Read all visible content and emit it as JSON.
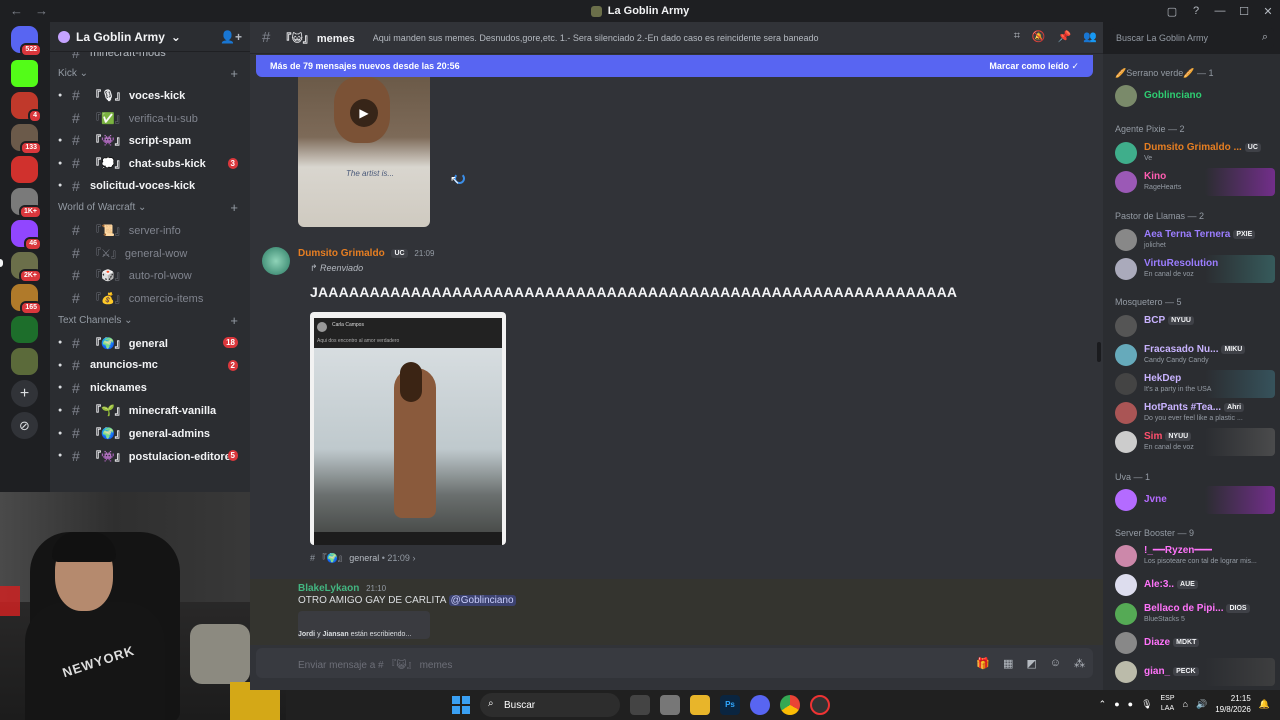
{
  "window": {
    "title": "La Goblin Army",
    "controls": [
      "▢",
      "?",
      "—",
      "☐",
      "✕"
    ]
  },
  "server_rail": {
    "badges": [
      "522",
      "4",
      "133",
      "1K+",
      "46",
      "2K+",
      "165"
    ]
  },
  "sidebar": {
    "server_name": "La Goblin Army",
    "top_cut_channel": "minecraft-mods",
    "categories": [
      {
        "name": "Kick",
        "channels": [
          {
            "label": "『🎙』 voces-kick",
            "unread": true,
            "mention": ""
          },
          {
            "label": "『✅』 verifica-tu-sub",
            "unread": false,
            "mention": ""
          },
          {
            "label": "『👾』 script-spam",
            "unread": true,
            "mention": ""
          },
          {
            "label": "『💭』 chat-subs-kick",
            "unread": true,
            "mention": "3"
          },
          {
            "label": "solicitud-voces-kick",
            "unread": true,
            "mention": ""
          }
        ]
      },
      {
        "name": "World of Warcraft",
        "channels": [
          {
            "label": "『📜』 server-info",
            "unread": false,
            "mention": ""
          },
          {
            "label": "『⚔』 general-wow",
            "unread": false,
            "mention": ""
          },
          {
            "label": "『🎲』 auto-rol-wow",
            "unread": false,
            "mention": ""
          },
          {
            "label": "『💰』 comercio-items",
            "unread": false,
            "mention": ""
          }
        ]
      },
      {
        "name": "Text Channels",
        "channels": [
          {
            "label": "『🌍』 general",
            "unread": true,
            "mention": "18"
          },
          {
            "label": "anuncios-mc",
            "unread": true,
            "mention": "2"
          },
          {
            "label": "nicknames",
            "unread": true,
            "mention": ""
          },
          {
            "label": "『🌱』 minecraft-vanilla",
            "unread": true,
            "mention": ""
          },
          {
            "label": "『🌍』 general-admins",
            "unread": true,
            "mention": ""
          },
          {
            "label": "『👾』 postulacion-editores",
            "unread": true,
            "mention": "5"
          }
        ]
      }
    ]
  },
  "webcam": {
    "hoodie_text": "NEWYORK"
  },
  "chat": {
    "channel_name": "『😺』 memes",
    "topic": "Aqui manden sus memes. Desnudos,gore,etc. 1.- Sera silenciado 2.-En dado caso es reincidente sera baneado",
    "banner_text": "Más de 79 mensajes nuevos desde las 20:56",
    "banner_action": "Marcar como leído",
    "messages": [
      {
        "author": "Dumsito Grimaldo",
        "author_color": "#e67e22",
        "tag": "UC",
        "time": "21:09",
        "forwarded_label": "Reenviado",
        "content": "JAAAAAAAAAAAAAAAAAAAAAAAAAAAAAAAAAAAAAAAAAAAAAAAAAAAAAAAAAAAAAA",
        "embed_author": "Carla Campos",
        "embed_text": "Aqui dos encontro al amor verdadero",
        "source_channel": "『🌍』 general",
        "source_time": "21:09"
      },
      {
        "author": "BlakeLykaon",
        "author_color": "#43b581",
        "time": "21:10",
        "content": "OTRO AMIGO GAY DE CARLITA",
        "mention": "@Goblinciano"
      }
    ],
    "typing": {
      "user1": "Jordi",
      "joiner": "y",
      "user2": "Jiansan",
      "suffix": "están escribiendo..."
    },
    "composer_placeholder": "Enviar mensaje a # 『😺』 memes"
  },
  "members": {
    "search_placeholder": "Buscar La Goblin Army",
    "groups": [
      {
        "title": "🥖Serrano verde🥖 — 1",
        "members": [
          {
            "name": "Goblinciano",
            "color": "#2ecc71",
            "tag": "",
            "status": ""
          }
        ]
      },
      {
        "title": "Agente Pixie — 2",
        "members": [
          {
            "name": "Dumsito Grimaldo ...",
            "color": "#e67e22",
            "tag": "UC",
            "status": "Ve"
          },
          {
            "name": "Kino",
            "color": "#ff5db1",
            "tag": "",
            "status": "RageHearts"
          }
        ]
      },
      {
        "title": "Pastor de Llamas — 2",
        "members": [
          {
            "name": "Aea Terna Ternera",
            "color": "#9b7dff",
            "tag": "PXIE",
            "status": "jolichet"
          },
          {
            "name": "VirtuResolution",
            "color": "#9b7dff",
            "tag": "",
            "status": "En canal de voz"
          }
        ]
      },
      {
        "title": "Mosquetero — 5",
        "members": [
          {
            "name": "BCP",
            "color": "#c9b3ff",
            "tag": "NYUU",
            "status": ""
          },
          {
            "name": "Fracasado Nu...",
            "color": "#c9b3ff",
            "tag": "MIKU",
            "status": "Candy Candy Candy"
          },
          {
            "name": "HekDep",
            "color": "#c9b3ff",
            "tag": "",
            "status": "It's a party in the USA"
          },
          {
            "name": "HotPants #Tea...",
            "color": "#c9b3ff",
            "tag": "Ahri",
            "status": "Do you ever feel like a plastic ..."
          },
          {
            "name": "Sim",
            "color": "#ff4f6d",
            "tag": "NYUU",
            "status": "En canal de voz"
          }
        ]
      },
      {
        "title": "Uva — 1",
        "members": [
          {
            "name": "Jvne",
            "color": "#b46bff",
            "tag": "",
            "status": ""
          }
        ]
      },
      {
        "title": "Server Booster — 9",
        "members": [
          {
            "name": "!_━━Ryzen━━━",
            "color": "#ff73fa",
            "tag": "",
            "status": "Los pisoteare con tal de lograr mis..."
          },
          {
            "name": "Ale:3..",
            "color": "#ff73fa",
            "tag": "AUE",
            "status": ""
          },
          {
            "name": "Bellaco de Pipi...",
            "color": "#ff73fa",
            "tag": "DIOS",
            "status": "BlueStacks 5"
          },
          {
            "name": "Diaze",
            "color": "#ff73fa",
            "tag": "MDKT",
            "status": ""
          },
          {
            "name": "gian_",
            "color": "#ff73fa",
            "tag": "PECK",
            "status": ""
          }
        ]
      }
    ]
  },
  "taskbar": {
    "search_label": "Buscar",
    "lang_top": "ESP",
    "lang_bottom": "LAA",
    "time": "21:15",
    "date": "19/8/2026"
  }
}
